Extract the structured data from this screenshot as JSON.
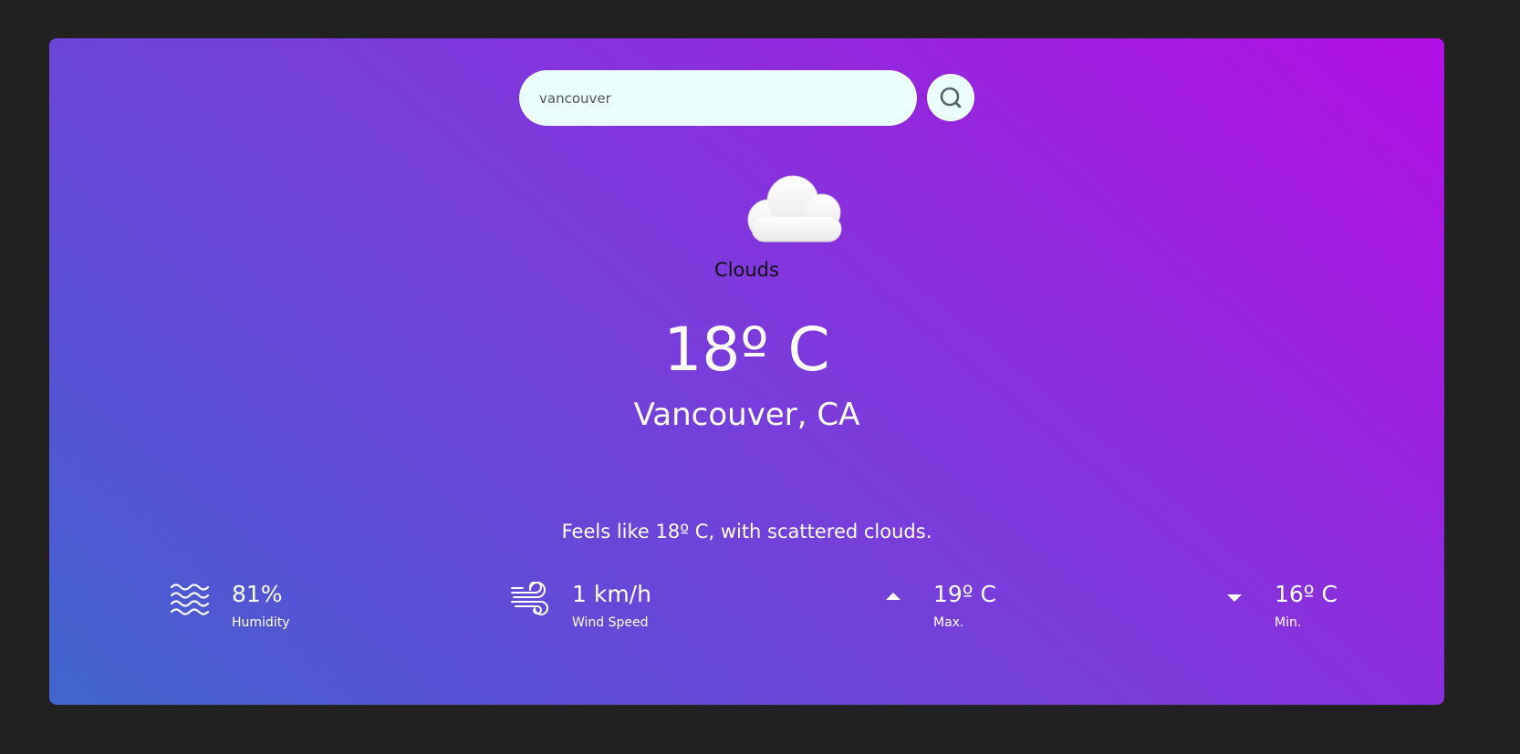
{
  "search": {
    "value": "vancouver",
    "icon": "search-icon"
  },
  "current": {
    "icon": "cloud-icon",
    "condition": "Clouds",
    "temperature": "18º C",
    "location": "Vancouver, CA",
    "description": "Feels like 18º C, with scattered clouds."
  },
  "stats": {
    "humidity": {
      "value": "81%",
      "label": "Humidity",
      "icon": "humidity-waves-icon"
    },
    "wind": {
      "value": "1 km/h",
      "label": "Wind Speed",
      "icon": "wind-icon"
    },
    "max": {
      "value": "19º C",
      "label": "Max.",
      "icon": "caret-up-icon"
    },
    "min": {
      "value": "16º C",
      "label": "Min.",
      "icon": "caret-down-icon"
    }
  },
  "colors": {
    "page_background": "#212121",
    "gradient_start": "#3f66cc",
    "gradient_end": "#b30fe6",
    "search_background": "#eafffb"
  }
}
